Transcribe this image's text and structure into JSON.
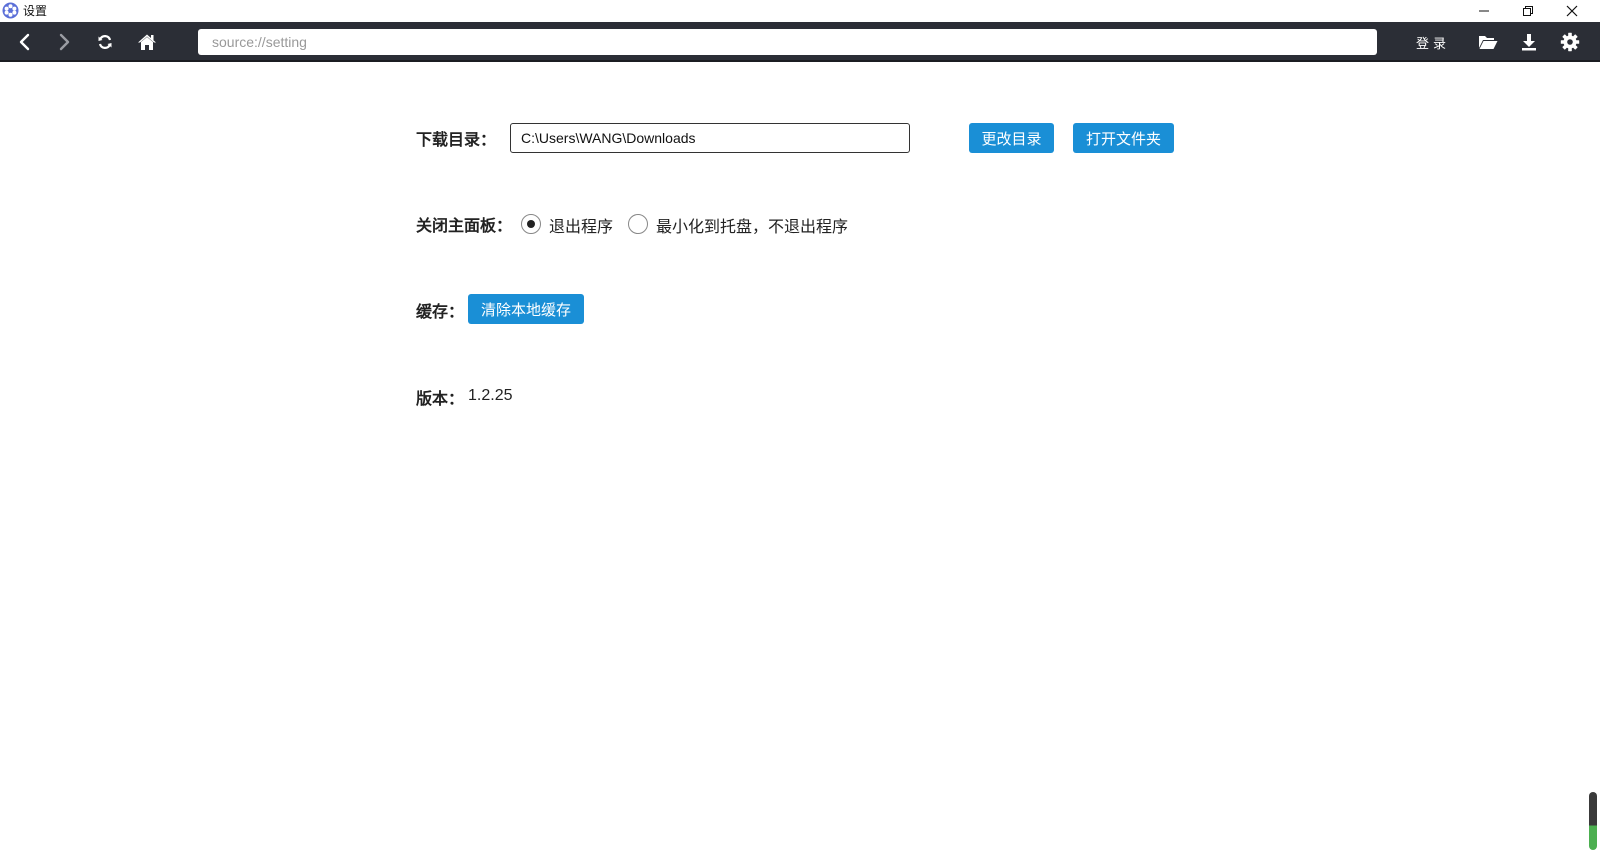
{
  "window": {
    "title": "设置",
    "controls": [
      "minimize",
      "restore",
      "close"
    ]
  },
  "toolbar": {
    "address": "source://setting",
    "login_label": "登录",
    "icons": [
      "back-icon",
      "forward-icon",
      "refresh-icon",
      "home-icon",
      "folder-open-icon",
      "download-icon",
      "gear-icon"
    ]
  },
  "settings": {
    "download_dir": {
      "label": "下载目录：",
      "value": "C:\\Users\\WANG\\Downloads",
      "change_button": "更改目录",
      "open_button": "打开文件夹"
    },
    "close_panel": {
      "label": "关闭主面板：",
      "options": [
        {
          "label": "退出程序",
          "checked": true
        },
        {
          "label": "最小化到托盘，不退出程序",
          "checked": false
        }
      ]
    },
    "cache": {
      "label": "缓存：",
      "clear_button": "清除本地缓存"
    },
    "version": {
      "label": "版本：",
      "value": "1.2.25"
    }
  },
  "colors": {
    "toolbar_bg": "#2b2e36",
    "button_blue": "#1a8fd6",
    "scroll_green": "#4caf50"
  }
}
